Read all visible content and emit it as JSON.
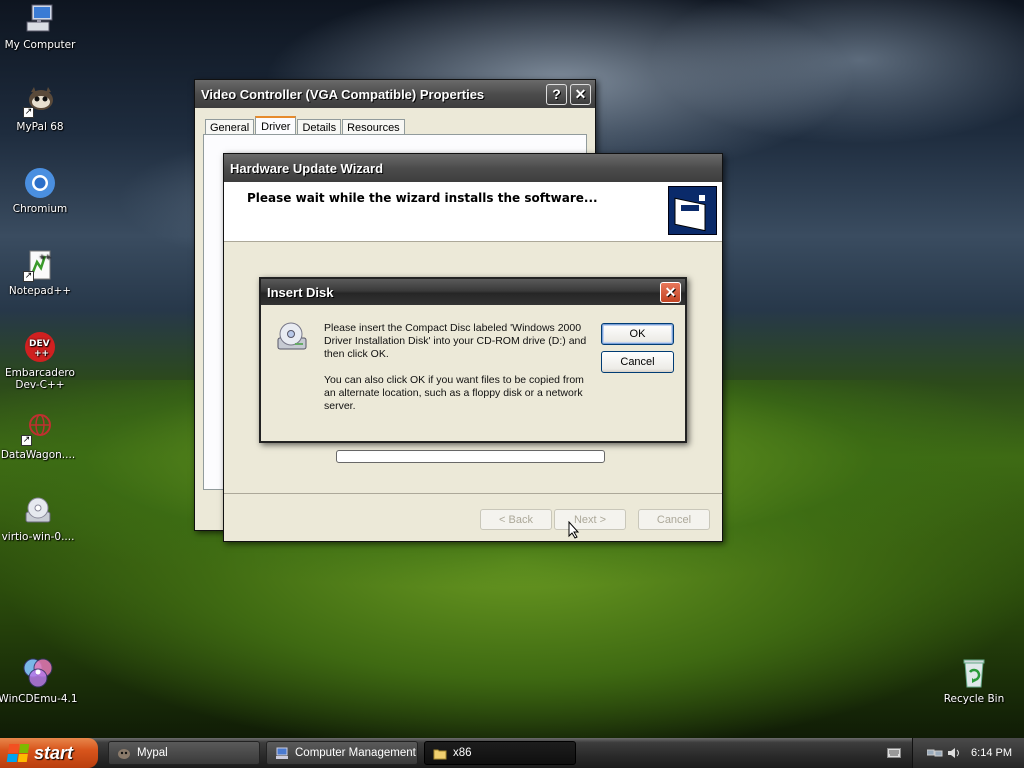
{
  "desktop_icons": [
    {
      "label": "My Computer",
      "icon": "computer-icon"
    },
    {
      "label": "MyPal 68",
      "icon": "mypal-icon"
    },
    {
      "label": "Chromium",
      "icon": "chromium-icon"
    },
    {
      "label": "Notepad++",
      "icon": "notepad-plus-plus-icon"
    },
    {
      "label": "Embarcadero Dev-C++",
      "icon": "devcpp-icon"
    },
    {
      "label": "DataWagon....",
      "icon": "datawagon-icon"
    },
    {
      "label": "virtio-win-0....",
      "icon": "disc-image-icon"
    },
    {
      "label": "WinCDEmu-4.1",
      "icon": "wincdemu-icon"
    },
    {
      "label": "Recycle Bin",
      "icon": "recycle-bin-icon"
    }
  ],
  "properties_window": {
    "title": "Video Controller (VGA Compatible) Properties",
    "help_button": "?",
    "close_button": "✕",
    "tabs": [
      "General",
      "Driver",
      "Details",
      "Resources"
    ],
    "active_tab": "Driver"
  },
  "wizard": {
    "title": "Hardware Update Wizard",
    "heading": "Please wait while the wizard installs the software...",
    "progress": 0,
    "back_label": "< Back",
    "next_label": "Next >",
    "cancel_label": "Cancel"
  },
  "insert_disk": {
    "title": "Insert Disk",
    "message1": "Please insert the Compact Disc labeled 'Windows 2000 Driver Installation Disk' into your CD-ROM drive (D:) and then click OK.",
    "message2": "You can also click OK if you want files to be copied from an alternate location, such as a floppy disk or a network server.",
    "ok_label": "OK",
    "cancel_label": "Cancel",
    "close_button": "✕"
  },
  "taskbar": {
    "start_label": "start",
    "tasks": [
      {
        "label": "Mypal",
        "icon": "mypal-icon"
      },
      {
        "label": "Computer Management",
        "icon": "computer-management-icon"
      },
      {
        "label": "x86",
        "icon": "folder-icon"
      }
    ],
    "clock": "6:14 PM"
  },
  "colors": {
    "xp_face": "#ece9d8",
    "title_dark": "#333333",
    "close_red": "#d2522e",
    "start_orange": "#d8551c"
  }
}
